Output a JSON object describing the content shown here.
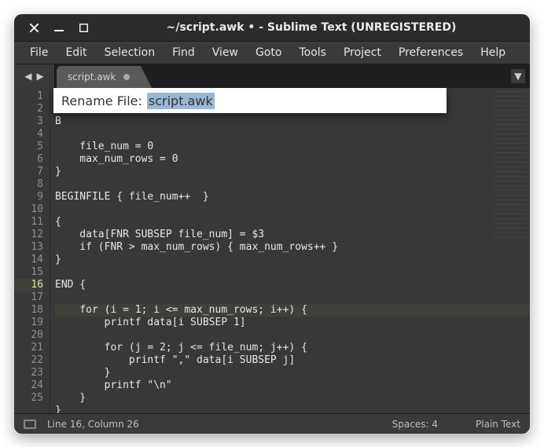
{
  "window": {
    "title": "~/script.awk • - Sublime Text (UNREGISTERED)"
  },
  "menubar": {
    "items": [
      "File",
      "Edit",
      "Selection",
      "Find",
      "View",
      "Goto",
      "Tools",
      "Project",
      "Preferences",
      "Help"
    ]
  },
  "tab": {
    "name": "script.awk",
    "dirty": true
  },
  "rename_prompt": {
    "label": "Rename File:",
    "value": "script.awk"
  },
  "code": {
    "lines": [
      "B",
      "    ",
      "    file_num = 0",
      "    max_num_rows = 0",
      "}",
      "",
      "BEGINFILE { file_num++  }",
      "",
      "{",
      "    data[FNR SUBSEP file_num] = $3",
      "    if (FNR > max_num_rows) { max_num_rows++ }",
      "}",
      "",
      "END {",
      "",
      "    for (i = 1; i <= max_num_rows; i++) {",
      "        printf data[i SUBSEP 1]",
      "",
      "        for (j = 2; j <= file_num; j++) {",
      "            printf \",\" data[i SUBSEP j]",
      "        }",
      "        printf \"\\n\"",
      "    }",
      "}",
      ""
    ],
    "current_line_index": 15
  },
  "statusbar": {
    "position": "Line 16, Column 26",
    "spaces": "Spaces: 4",
    "syntax": "Plain Text"
  }
}
